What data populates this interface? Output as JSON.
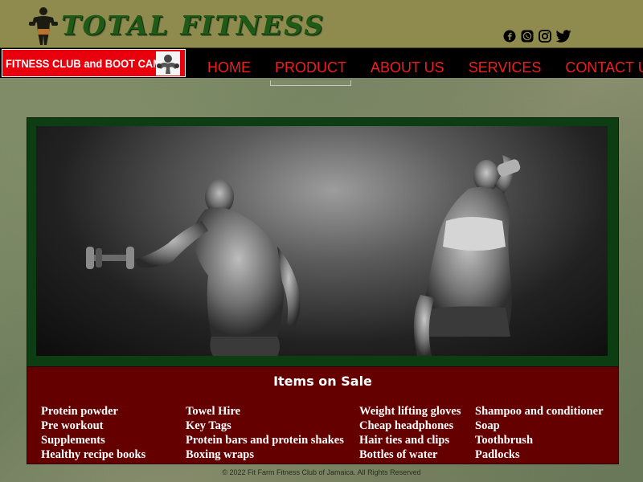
{
  "header": {
    "brand_title": "TOTAL FITNESS",
    "logo_icon": "bodybuilder-logo-icon",
    "colors": {
      "bar": "#8f8b4f",
      "title": "#1f5b16"
    },
    "social": [
      {
        "name": "facebook-icon"
      },
      {
        "name": "whatsapp-icon"
      },
      {
        "name": "instagram-icon"
      },
      {
        "name": "twitter-icon"
      }
    ]
  },
  "banner": {
    "text": "FITNESS CLUB and BOOT CAMP",
    "mascot_icon": "muscle-mascot-icon",
    "color": "#e8000c"
  },
  "nav": {
    "items": [
      {
        "label": "HOME"
      },
      {
        "label": "PRODUCT",
        "active": true
      },
      {
        "label": "ABOUT US"
      },
      {
        "label": "SERVICES"
      },
      {
        "label": "CONTACT US"
      }
    ],
    "color": "#f11d1d"
  },
  "hero": {
    "image": "gym-couple-photo"
  },
  "items_section": {
    "title": "Items on Sale",
    "color": "#640000",
    "columns": [
      [
        "Protein powder",
        "Pre workout",
        "Supplements",
        "Healthy recipe books"
      ],
      [
        "Towel Hire",
        "Key Tags",
        "Protein bars and protein shakes",
        "Boxing wraps"
      ],
      [
        "Weight lifting gloves",
        "Cheap headphones",
        "Hair ties and clips",
        "Bottles of water"
      ],
      [
        "Shampoo and conditioner",
        "Soap",
        "Toothbrush",
        "Padlocks"
      ]
    ]
  },
  "footer": {
    "text": "©  2022 Fit Farm Fitness Club of Jamaica.  All Rights Reserved"
  }
}
